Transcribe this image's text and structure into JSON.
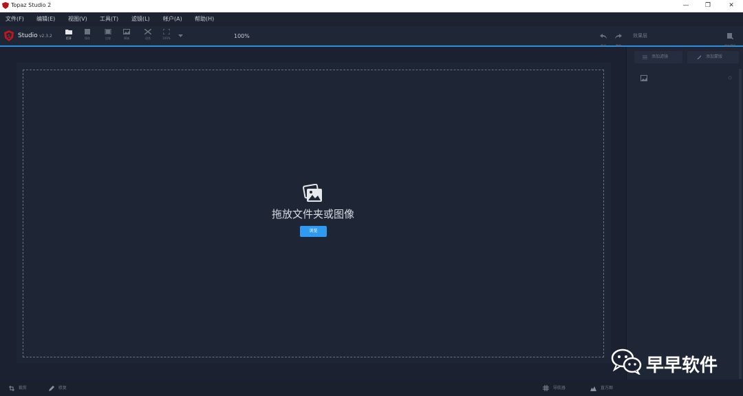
{
  "window": {
    "title": "Topaz Studio 2",
    "minimize": "—",
    "restore": "❐",
    "close": "✕"
  },
  "menu": [
    "文件(F)",
    "编辑(E)",
    "视图(V)",
    "工具(T)",
    "滤镜(L)",
    "帐户(A)",
    "帮助(H)"
  ],
  "app": {
    "name": "Studio",
    "version": "v2.3.2"
  },
  "toolbar": {
    "open": "打开",
    "save": "保存",
    "compare": "比较",
    "original": "原始",
    "fit": "适合",
    "zoom100": "100%",
    "zoom_value": "100%",
    "undo": "撤消",
    "redo": "重做",
    "panel_label": "效果层",
    "presets": "保存预设"
  },
  "panel": {
    "add_filter": "添加滤镜",
    "mask": "添加蒙版"
  },
  "canvas": {
    "drop_text": "拖放文件夹或图像",
    "browse": "浏览"
  },
  "bottom": {
    "crop": "裁剪",
    "brush": "修复",
    "grid": "导航器",
    "histogram": "直方图"
  },
  "watermark": {
    "text": "早早软件"
  },
  "colors": {
    "accent": "#2e9bf0",
    "background": "#1b2130"
  }
}
